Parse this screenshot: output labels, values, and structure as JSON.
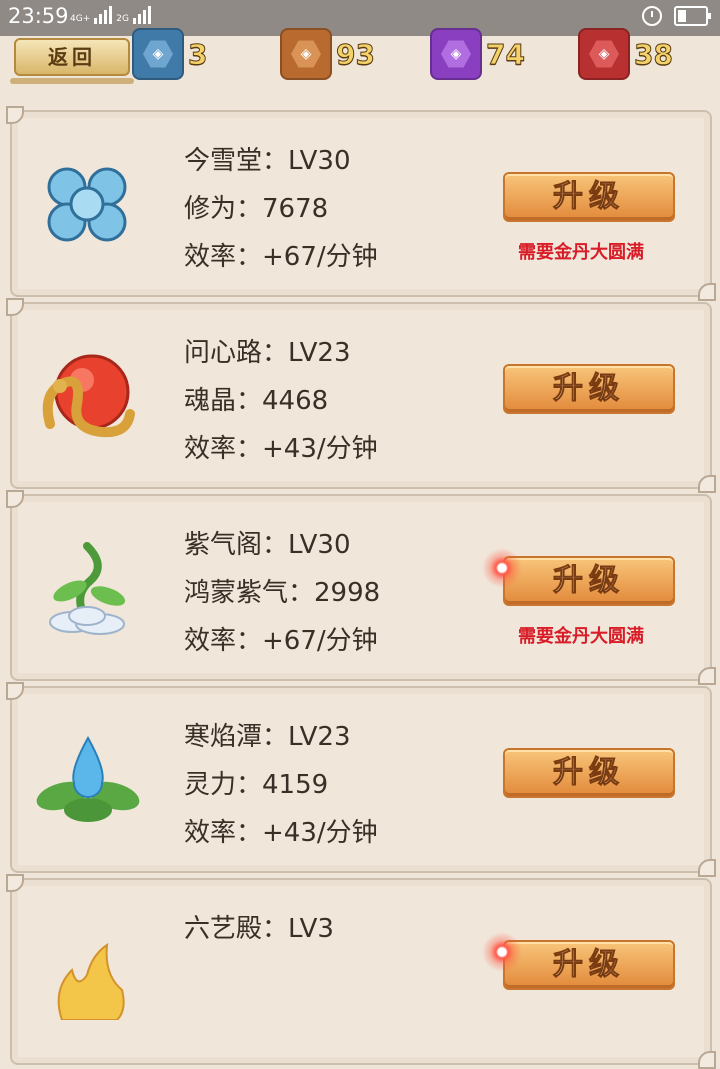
{
  "status_bar": {
    "time": "23:59",
    "net1": "4G+",
    "net2": "2G"
  },
  "top_bar": {
    "back_label": "返回",
    "currencies": [
      {
        "icon": "blue-gem-icon",
        "amount": "3",
        "color": "#3f7aa8"
      },
      {
        "icon": "bronze-gem-icon",
        "amount": "93",
        "color": "#b86a2f"
      },
      {
        "icon": "purple-gem-icon",
        "amount": "74",
        "color": "#8a3fc0"
      },
      {
        "icon": "red-gem-icon",
        "amount": "38",
        "color": "#b83030"
      }
    ]
  },
  "buildings": [
    {
      "icon": "blue-cloud-knot-icon",
      "name_line": "今雪堂：LV30",
      "resource_line": "修为：7678",
      "rate_line": "效率：+67/分钟",
      "button_label": "升级",
      "requirement": "需要金丹大圆满",
      "sparkle": false
    },
    {
      "icon": "golden-dragon-orb-icon",
      "name_line": "问心路：LV23",
      "resource_line": "魂晶：4468",
      "rate_line": "效率：+43/分钟",
      "button_label": "升级",
      "requirement": "",
      "sparkle": false
    },
    {
      "icon": "green-vine-cloud-icon",
      "name_line": "紫气阁：LV30",
      "resource_line": "鸿蒙紫气：2998",
      "rate_line": "效率：+67/分钟",
      "button_label": "升级",
      "requirement": "需要金丹大圆满",
      "sparkle": true
    },
    {
      "icon": "water-drop-leaf-icon",
      "name_line": "寒焰潭：LV23",
      "resource_line": "灵力：4159",
      "rate_line": "效率：+43/分钟",
      "button_label": "升级",
      "requirement": "",
      "sparkle": false
    },
    {
      "icon": "golden-flame-icon",
      "name_line": "六艺殿：LV3",
      "resource_line": "",
      "rate_line": "",
      "button_label": "升级",
      "requirement": "",
      "sparkle": true
    }
  ]
}
